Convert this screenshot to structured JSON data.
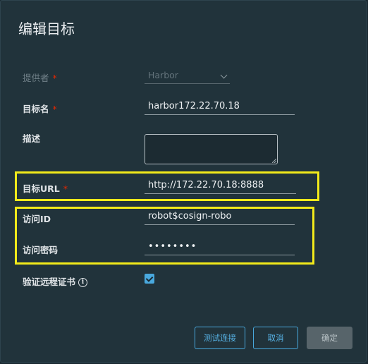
{
  "dialog": {
    "title": "编辑目标"
  },
  "form": {
    "provider": {
      "label": "提供者",
      "required_mark": "*",
      "value": "Harbor"
    },
    "target_name": {
      "label": "目标名",
      "required_mark": "*",
      "value": "harbor172.22.70.18"
    },
    "description": {
      "label": "描述",
      "value": ""
    },
    "target_url": {
      "label": "目标URL",
      "required_mark": "*",
      "value": "http://172.22.70.18:8888"
    },
    "access_id": {
      "label": "访问ID",
      "value": "robot$cosign-robo"
    },
    "access_secret": {
      "label": "访问密码",
      "value": "••••••••"
    },
    "verify_cert": {
      "label": "验证远程证书",
      "checked": true,
      "info_icon": "i"
    }
  },
  "buttons": {
    "test_connection": "测试连接",
    "cancel": "取消",
    "ok": "确定"
  },
  "colors": {
    "background": "#21333b",
    "highlight": "#f2ea1a",
    "accent": "#49a9de",
    "required": "#e62700"
  }
}
